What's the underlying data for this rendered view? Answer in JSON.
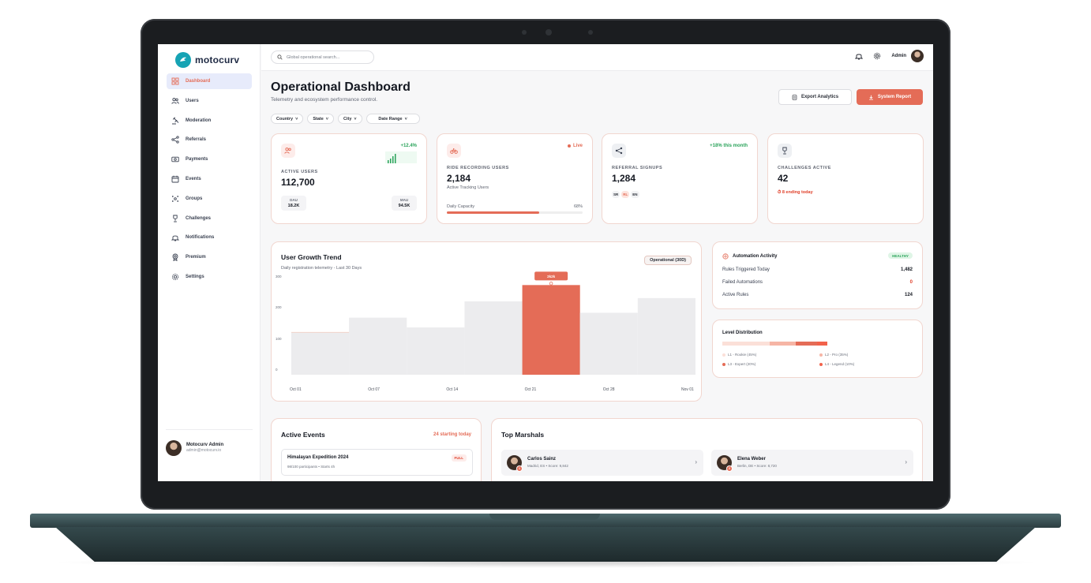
{
  "app": {
    "brand": "motocurv"
  },
  "sidebar": {
    "items": [
      {
        "label": "Dashboard",
        "icon": "grid-icon",
        "active": true
      },
      {
        "label": "Users",
        "icon": "users-icon"
      },
      {
        "label": "Moderation",
        "icon": "gavel-icon"
      },
      {
        "label": "Referrals",
        "icon": "share-icon"
      },
      {
        "label": "Payments",
        "icon": "payments-icon"
      },
      {
        "label": "Events",
        "icon": "calendar-icon"
      },
      {
        "label": "Groups",
        "icon": "groups-icon"
      },
      {
        "label": "Challenges",
        "icon": "trophy-icon"
      },
      {
        "label": "Notifications",
        "icon": "bell-icon"
      },
      {
        "label": "Premium",
        "icon": "premium-icon"
      },
      {
        "label": "Settings",
        "icon": "gear-icon"
      }
    ],
    "profile": {
      "name": "Motocurv Admin",
      "email": "admin@motocurv.io"
    }
  },
  "topbar": {
    "search_placeholder": "Global operational search...",
    "user": "Admin"
  },
  "header": {
    "title": "Operational Dashboard",
    "subtitle": "Telemetry and ecosystem performance control.",
    "filters": [
      "Country",
      "State",
      "City",
      "Date Range"
    ],
    "export_label": "Export Analytics",
    "report_label": "System Report"
  },
  "stats": {
    "active_users": {
      "label": "ACTIVE USERS",
      "value": "112,700",
      "trend": "+12.4%",
      "dau_label": "DAU",
      "dau": "18.2K",
      "mau_label": "MAU",
      "mau": "94.5K"
    },
    "ride_recording": {
      "label": "RIDE RECORDING USERS",
      "value": "2,184",
      "status": "Live",
      "sub": "Active Tracking Users",
      "capacity_label": "Daily Capacity",
      "capacity_pct": "68%",
      "capacity_value": 0.68
    },
    "referrals": {
      "label": "REFERRAL SIGNUPS",
      "value": "1,284",
      "trend": "+18% this month",
      "tags": [
        "SR",
        "RL",
        "EN"
      ]
    },
    "challenges": {
      "label": "CHALLENGES ACTIVE",
      "value": "42",
      "note": "8 ending today"
    }
  },
  "growth": {
    "title": "User Growth Trend",
    "subtitle": "Daily registration telemetry - Last 30 Days",
    "badge": "Operational (30D)",
    "tooltip": "2k2k"
  },
  "chart_data": {
    "type": "bar",
    "x_tick_labels": [
      "Oct 01",
      "Oct 07",
      "Oct 14",
      "Oct 21",
      "Oct 28",
      "Nov 01"
    ],
    "y_tick_labels": [
      "300",
      "200",
      "100",
      "0"
    ],
    "ylim": [
      0,
      300
    ],
    "values": [
      130,
      175,
      145,
      225,
      275,
      190,
      235
    ],
    "highlight_index": 4,
    "colors": {
      "bar": "#ececee",
      "highlight": "#e46c57"
    }
  },
  "automation": {
    "title": "Automation Activity",
    "status": "HEALTHY",
    "rows": [
      {
        "label": "Rules Triggered Today",
        "value": "1,482"
      },
      {
        "label": "Failed Automations",
        "value": "0"
      },
      {
        "label": "Active Rules",
        "value": "124"
      }
    ]
  },
  "level": {
    "title": "Level Distribution",
    "legend": [
      "L1 - Rookie (45%)",
      "L2 - Pro (35%)",
      "L3 - Expert (20%)",
      "L4 - Legend (10%)"
    ],
    "shares": [
      0.45,
      0.25,
      0.2,
      0.1
    ],
    "colors": [
      "#fbe0d8",
      "#f6b5a5",
      "#e46c57",
      "#f2624b"
    ]
  },
  "events": {
    "title": "Active Events",
    "count": "24 starting today",
    "item": {
      "name": "Himalayan Expedition 2024",
      "meta": "98/100 participants • Starts 4h",
      "badge": "FULL"
    }
  },
  "marshals": {
    "title": "Top Marshals",
    "items": [
      {
        "name": "Carlos Sainz",
        "meta": "Madrid, ES • Score: 9,842",
        "rank": "1"
      },
      {
        "name": "Elena Weber",
        "meta": "Berlin, DE • Score: 8,720",
        "rank": "2"
      }
    ]
  }
}
